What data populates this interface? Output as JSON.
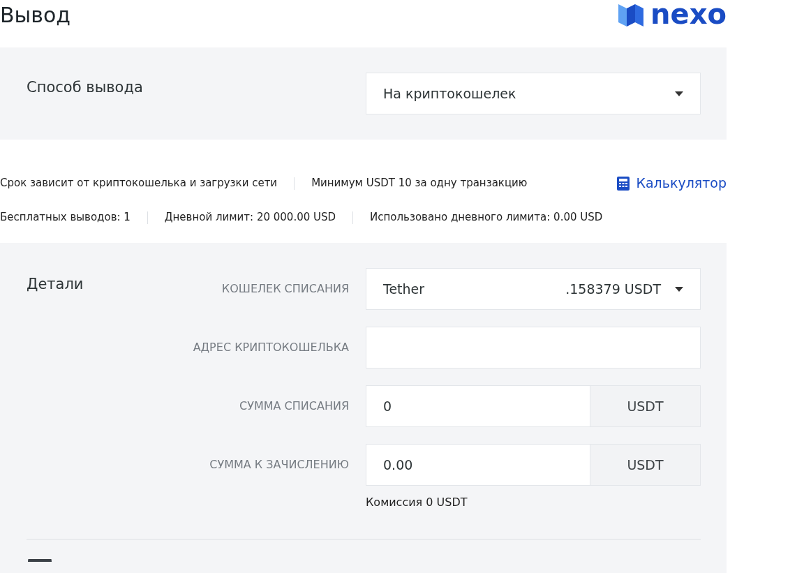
{
  "page_title": "Вывод",
  "logo": {
    "text": "nexo"
  },
  "method": {
    "label": "Способ вывода",
    "value": "На криптокошелек"
  },
  "info_rows": [
    [
      "Срок зависит от криптокошелька и загрузки сети",
      "Минимум USDT 10 за одну транзакцию"
    ],
    [
      "Бесплатных выводов: 1",
      "Дневной лимит: 20 000.00 USD",
      "Использовано дневного лимита: 0.00 USD"
    ]
  ],
  "calculator_link": "Калькулятор",
  "details": {
    "title": "Детали",
    "fields": [
      {
        "kind": "select",
        "label": "КОШЕЛЕК СПИСАНИЯ",
        "value": "Tether",
        "balance": ".158379 USDT"
      },
      {
        "kind": "input",
        "label": "АДРЕС КРИПТОКОШЕЛЬКА"
      },
      {
        "kind": "amount",
        "label": "СУММА СПИСАНИЯ",
        "value": "0",
        "currency": "USDT"
      },
      {
        "kind": "amount",
        "label": "СУММА К ЗАЧИСЛЕНИЮ",
        "value": "0.00",
        "currency": "USDT",
        "note": "Комиссия 0 USDT"
      }
    ]
  }
}
